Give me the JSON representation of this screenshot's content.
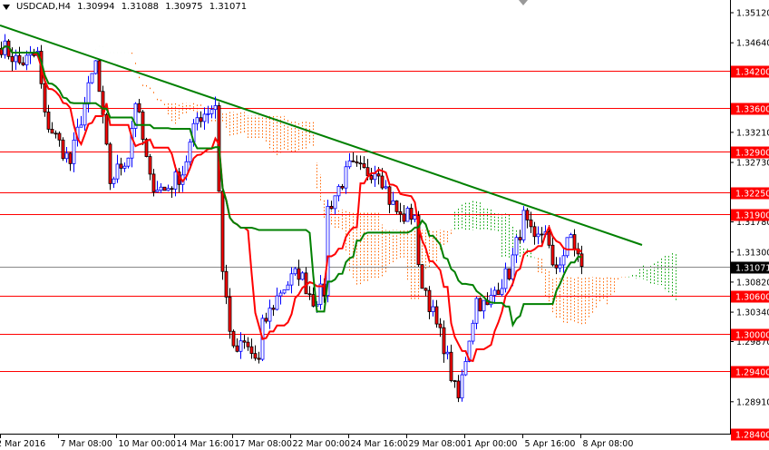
{
  "header": {
    "symbol": "USDCAD,H4",
    "open": "1.30994",
    "high": "1.31088",
    "low": "1.30975",
    "close": "1.31071"
  },
  "chart_data": {
    "type": "candlestick",
    "title": "USDCAD,H4",
    "indicator": "Ichimoku Kinko Hyo",
    "ylim": [
      1.284,
      1.3512
    ],
    "price_ticks": [
      "1.35120",
      "1.34640",
      "1.33210",
      "1.32730",
      "1.31780",
      "1.31300",
      "1.30820",
      "1.30340",
      "1.29870",
      "1.28910"
    ],
    "levels": [
      "1.34200",
      "1.33600",
      "1.32900",
      "1.32250",
      "1.31900",
      "1.30600",
      "1.30000",
      "1.29400",
      "1.28400"
    ],
    "current_price": "1.31071",
    "x_labels": [
      "2 Mar 2016",
      "7 Mar 08:00",
      "10 Mar 00:00",
      "14 Mar 16:00",
      "17 Mar 08:00",
      "22 Mar 00:00",
      "24 Mar 16:00",
      "29 Mar 08:00",
      "1 Apr 00:00",
      "5 Apr 16:00",
      "8 Apr 08:00"
    ],
    "candles_per_label": 16,
    "close_waypoints": [
      [
        0,
        1.346
      ],
      [
        5,
        1.3431
      ],
      [
        10,
        1.3445
      ],
      [
        12,
        1.3344
      ],
      [
        19,
        1.3272
      ],
      [
        22,
        1.3344
      ],
      [
        26,
        1.3431
      ],
      [
        30,
        1.3243
      ],
      [
        35,
        1.3286
      ],
      [
        37,
        1.3373
      ],
      [
        41,
        1.3243
      ],
      [
        45,
        1.3228
      ],
      [
        50,
        1.3257
      ],
      [
        54,
        1.3344
      ],
      [
        59,
        1.3366
      ],
      [
        61,
        1.3098
      ],
      [
        64,
        1.2968
      ],
      [
        67,
        1.2982
      ],
      [
        71,
        1.2953
      ],
      [
        72,
        1.3011
      ],
      [
        77,
        1.3069
      ],
      [
        82,
        1.3098
      ],
      [
        86,
        1.3054
      ],
      [
        89,
        1.3069
      ],
      [
        90,
        1.3199
      ],
      [
        94,
        1.3243
      ],
      [
        96,
        1.3264
      ],
      [
        100,
        1.3257
      ],
      [
        104,
        1.3264
      ],
      [
        107,
        1.3214
      ],
      [
        110,
        1.3185
      ],
      [
        114,
        1.3192
      ],
      [
        115,
        1.3098
      ],
      [
        117,
        1.3069
      ],
      [
        120,
        1.3011
      ],
      [
        122,
        1.2982
      ],
      [
        125,
        1.291
      ],
      [
        126,
        1.2895
      ],
      [
        129,
        1.2996
      ],
      [
        131,
        1.3054
      ],
      [
        134,
        1.304
      ],
      [
        136,
        1.3069
      ],
      [
        140,
        1.3098
      ],
      [
        144,
        1.3185
      ],
      [
        147,
        1.3141
      ],
      [
        150,
        1.317
      ],
      [
        152,
        1.3098
      ],
      [
        155,
        1.3127
      ],
      [
        157,
        1.3156
      ],
      [
        160,
        1.3107
      ]
    ],
    "trendline": "descending resistance"
  },
  "colors": {
    "up": "#0000ff",
    "down": "#ff0000",
    "tenkan": "#ff0000",
    "kijun": "#008000",
    "cloud_bear": "#ff6600",
    "cloud_bull": "#00a000",
    "level": "#ff0000",
    "trend": "#008000"
  }
}
